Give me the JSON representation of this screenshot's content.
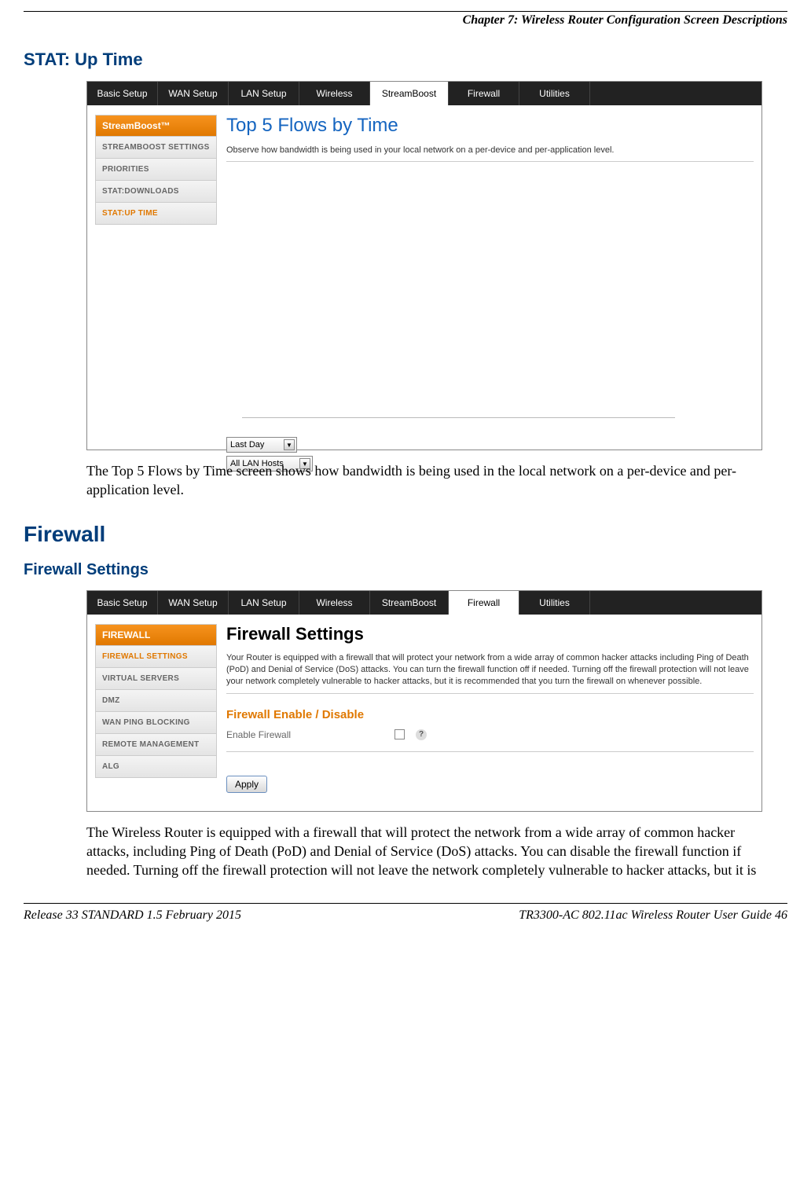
{
  "chapterHeader": "Chapter 7: Wireless Router Configuration Screen Descriptions",
  "section1Title": "STAT: Up Time",
  "screenshot1": {
    "tabs": [
      "Basic Setup",
      "WAN Setup",
      "LAN Setup",
      "Wireless",
      "StreamBoost",
      "Firewall",
      "Utilities"
    ],
    "activeTabIndex": 4,
    "tabWidths": [
      90,
      90,
      90,
      90,
      100,
      90,
      90
    ],
    "sidebarHeader": "StreamBoost™",
    "sidebarItems": [
      "STREAMBOOST SETTINGS",
      "PRIORITIES",
      "STAT:DOWNLOADS",
      "STAT:UP TIME"
    ],
    "sidebarActiveIndex": 3,
    "contentTitle": "Top 5 Flows by Time",
    "contentDesc": "Observe how bandwidth is being used in your local network on a per-device and per-application level.",
    "select1": "Last Day",
    "select2": "All LAN Hosts"
  },
  "para1": "The Top 5 Flows by Time screen shows how bandwidth is being used in the local network on a per-device and per-application level.",
  "section2Title": "Firewall",
  "section3Title": "Firewall Settings",
  "screenshot2": {
    "tabs": [
      "Basic Setup",
      "WAN Setup",
      "LAN Setup",
      "Wireless",
      "StreamBoost",
      "Firewall",
      "Utilities"
    ],
    "activeTabIndex": 5,
    "sidebarHeader": "FIREWALL",
    "sidebarItems": [
      "FIREWALL SETTINGS",
      "VIRTUAL SERVERS",
      "DMZ",
      "WAN PING BLOCKING",
      "REMOTE MANAGEMENT",
      "ALG"
    ],
    "sidebarActiveIndex": 0,
    "contentTitle": "Firewall Settings",
    "contentDesc": "Your Router is equipped with a firewall that will protect your network from a wide array of common hacker attacks including Ping of Death (PoD) and Denial of Service (DoS) attacks. You can turn the firewall function off if needed. Turning off the firewall protection will not leave your network completely vulnerable to hacker attacks, but it is recommended that you turn the firewall on whenever possible.",
    "subTitle": "Firewall Enable / Disable",
    "settingLabel": "Enable Firewall",
    "helpGlyph": "?",
    "applyLabel": "Apply"
  },
  "para2": "The Wireless Router is equipped with a firewall that will protect the network from a wide array of common hacker attacks, including Ping of Death (PoD) and Denial of Service (DoS) attacks.  You can disable the firewall function if needed.  Turning off the firewall protection will not leave the network completely vulnerable to hacker attacks, but it is",
  "footerLeft": "Release 33 STANDARD 1.5    February 2015",
  "footerRight": "TR3300-AC 802.11ac Wireless Router User Guide    46"
}
